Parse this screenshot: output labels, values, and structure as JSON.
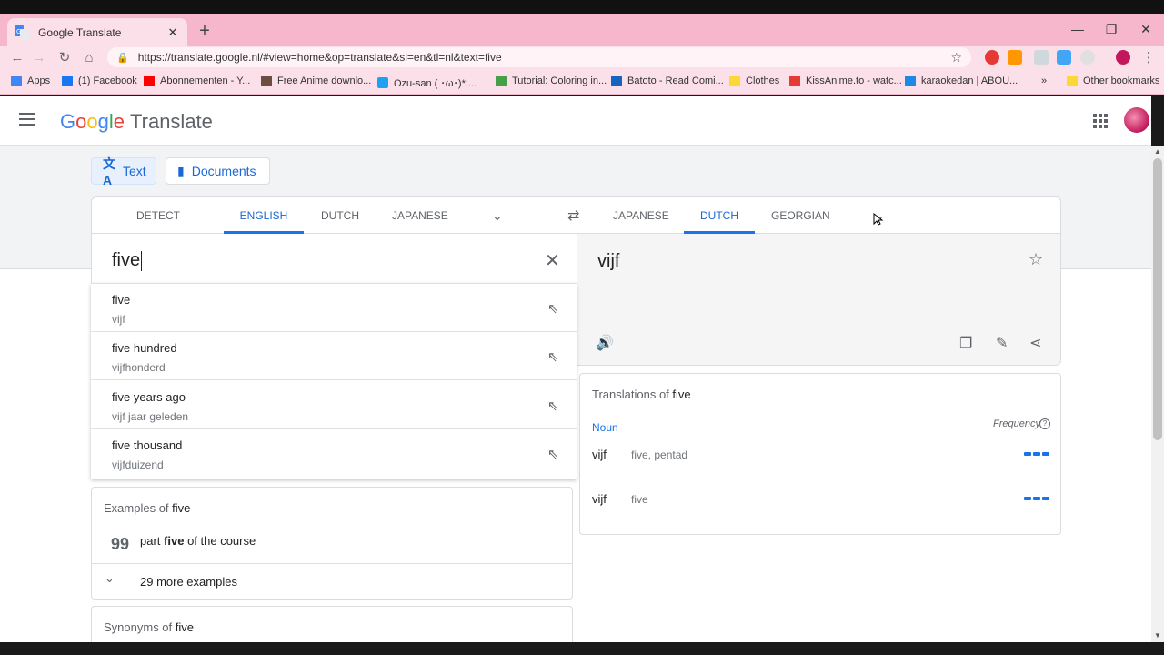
{
  "browser": {
    "tab_title": "Google Translate",
    "new_tab": "+",
    "url": "https://translate.google.nl/#view=home&op=translate&sl=en&tl=nl&text=five",
    "bookmarks": [
      {
        "label": "Apps",
        "color": "#4285f4"
      },
      {
        "label": "(1) Facebook",
        "color": "#1877f2"
      },
      {
        "label": "Abonnementen - Y...",
        "color": "#ff0000"
      },
      {
        "label": "Free Anime downlo...",
        "color": "#6d4c41"
      },
      {
        "label": "Ozu-san ( ･ω･)*:...",
        "color": "#1da1f2"
      },
      {
        "label": "Tutorial: Coloring in...",
        "color": "#43a047"
      },
      {
        "label": "Batoto - Read Comi...",
        "color": "#1565c0"
      },
      {
        "label": "Clothes",
        "color": "#fdd835"
      },
      {
        "label": "KissAnime.to - watc...",
        "color": "#e53935"
      },
      {
        "label": "karaokedan | ABOU...",
        "color": "#1e88e5"
      },
      {
        "label": "Other bookmarks",
        "color": "#fdd835"
      }
    ],
    "overflow": "»"
  },
  "header": {
    "logo_letters": [
      "G",
      "o",
      "o",
      "g",
      "l",
      "e"
    ],
    "product": "Translate"
  },
  "modes": {
    "text_label": "Text",
    "documents_label": "Documents"
  },
  "languages": {
    "source": [
      "DETECT LANGUAGE",
      "ENGLISH",
      "DUTCH",
      "JAPANESE"
    ],
    "source_active": "ENGLISH",
    "target": [
      "JAPANESE",
      "DUTCH",
      "GEORGIAN"
    ],
    "target_active": "DUTCH"
  },
  "source": {
    "text": "five"
  },
  "target": {
    "text": "vijf"
  },
  "suggestions": [
    {
      "source": "five",
      "target": "vijf"
    },
    {
      "source": "five hundred",
      "target": "vijfhonderd"
    },
    {
      "source": "five years ago",
      "target": "vijf jaar geleden"
    },
    {
      "source": "five thousand",
      "target": "vijfduizend"
    }
  ],
  "examples": {
    "title_prefix": "Examples of",
    "title_word": "five",
    "quote_mark": "99",
    "example_before": "part",
    "example_bold": "five",
    "example_after": "of the course",
    "more": "29 more examples"
  },
  "synonyms": {
    "title_prefix": "Synonyms of",
    "title_word": "five"
  },
  "translations": {
    "title_prefix": "Translations of",
    "title_word": "five",
    "part_of_speech": "Noun",
    "frequency_label": "Frequency",
    "rows": [
      {
        "word": "vijf",
        "reverse": "five, pentad"
      },
      {
        "word": "vijf",
        "reverse": "five"
      }
    ]
  },
  "colors": {
    "accent": "#1a73e8",
    "browser_tint": "#f6b6cc"
  }
}
